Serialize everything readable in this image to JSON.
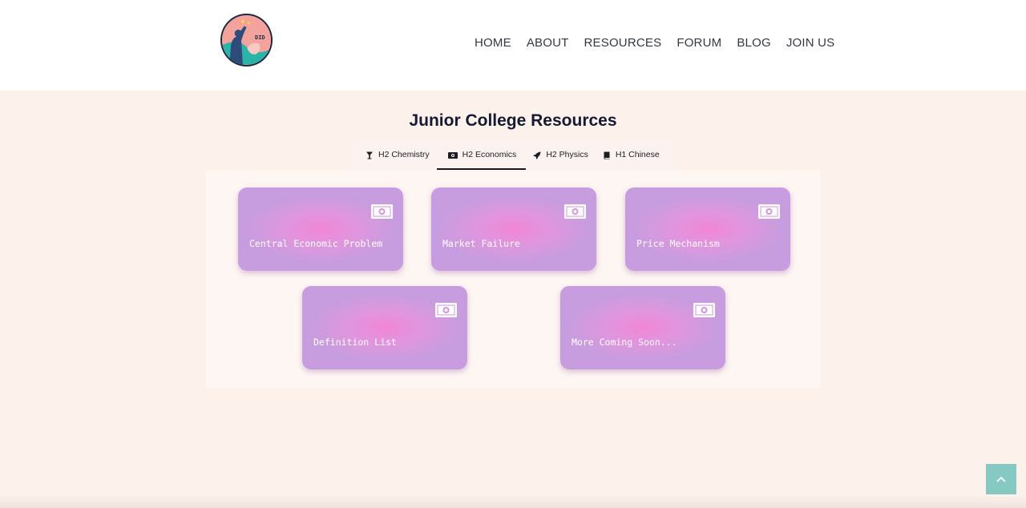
{
  "header": {
    "logo": {
      "icon": "site-logo-icon",
      "text": "DID"
    },
    "nav": [
      {
        "label": "HOME"
      },
      {
        "label": "ABOUT"
      },
      {
        "label": "RESOURCES"
      },
      {
        "label": "FORUM"
      },
      {
        "label": "BLOG"
      },
      {
        "label": "JOIN US"
      }
    ]
  },
  "main": {
    "title": "Junior College Resources",
    "tabs": [
      {
        "label": "H2 Chemistry",
        "icon": "flask-icon",
        "active": false
      },
      {
        "label": "H2 Economics",
        "icon": "money-icon",
        "active": true
      },
      {
        "label": "H2 Physics",
        "icon": "rocket-icon",
        "active": false
      },
      {
        "label": "H1 Chinese",
        "icon": "book-icon",
        "active": false
      }
    ],
    "cards": [
      {
        "label": "Central Economic Problem",
        "icon": "money-icon"
      },
      {
        "label": "Market Failure",
        "icon": "money-icon"
      },
      {
        "label": "Price Mechanism",
        "icon": "money-icon"
      },
      {
        "label": "Definition List",
        "icon": "money-icon"
      },
      {
        "label": "More Coming Soon...",
        "icon": "money-icon"
      }
    ]
  },
  "scroll_top": {
    "icon": "chevron-up-icon"
  },
  "colors": {
    "background": "#fdf1ec",
    "card_center": "#f286d6",
    "card_edge": "#c79ddf",
    "title": "#141a33",
    "scroll_top": "#86c8c2"
  }
}
